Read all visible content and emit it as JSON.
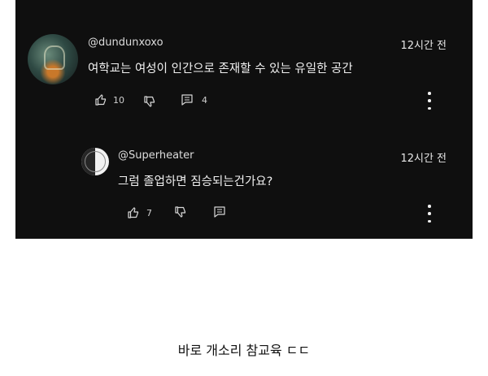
{
  "comments": [
    {
      "handle": "@dundunxoxo",
      "time": "12시간 전",
      "text": "여학교는 여성이 인간으로 존재할 수 있는 유일한 공간",
      "likes": "10",
      "replies": "4"
    },
    {
      "handle": "@Superheater",
      "time": "12시간 전",
      "text": "그럼 졸업하면 짐승되는건가요?",
      "likes": "7"
    }
  ],
  "caption": "바로 개소리 참교육 ㄷㄷ",
  "icons": {
    "like": "thumbs-up-icon",
    "dislike": "thumbs-down-icon",
    "reply": "reply-comment-icon",
    "more": "more-vertical-icon"
  },
  "colors": {
    "panel_bg": "#0f0f0f",
    "text": "#f1f1f1",
    "page_bg": "#ffffff"
  }
}
